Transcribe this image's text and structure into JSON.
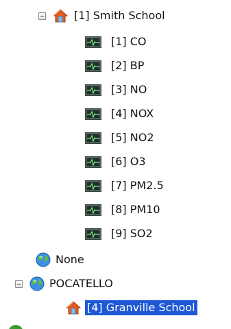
{
  "tree": {
    "school_1": {
      "label": "[1] Smith School",
      "children": [
        {
          "label": "[1] CO"
        },
        {
          "label": "[2] BP"
        },
        {
          "label": "[3] NO"
        },
        {
          "label": "[4] NOX"
        },
        {
          "label": "[5] NO2"
        },
        {
          "label": "[6] O3"
        },
        {
          "label": "[7] PM2.5"
        },
        {
          "label": "[8] PM10"
        },
        {
          "label": "[9] SO2"
        }
      ]
    },
    "none_node": {
      "label": "None"
    },
    "pocatello": {
      "label": "POCATELLO"
    },
    "granville": {
      "label": "[4] Granville School",
      "selected": true
    }
  },
  "icons": {
    "expander": "collapse-minus-icon",
    "school": "house-icon",
    "sensor": "sensor-monitor-icon",
    "site": "globe-icon"
  },
  "colors": {
    "selection_bg": "#1f58d6",
    "selection_text": "#ffffff"
  }
}
